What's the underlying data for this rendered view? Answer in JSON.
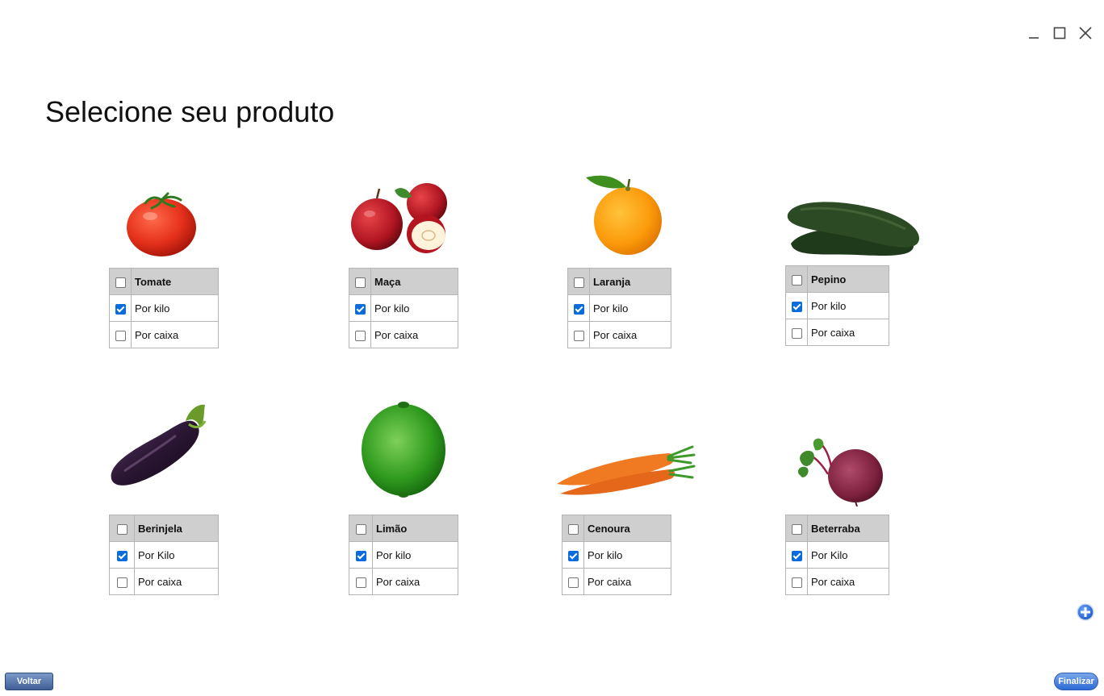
{
  "page": {
    "title": "Selecione seu produto"
  },
  "products": [
    {
      "name": "Tomate",
      "options": [
        {
          "label": "Por kilo",
          "checked": true
        },
        {
          "label": "Por caixa",
          "checked": false
        }
      ]
    },
    {
      "name": "Maça",
      "options": [
        {
          "label": "Por kilo",
          "checked": true
        },
        {
          "label": "Por caixa",
          "checked": false
        }
      ]
    },
    {
      "name": "Laranja",
      "options": [
        {
          "label": "Por kilo",
          "checked": true
        },
        {
          "label": "Por caixa",
          "checked": false
        }
      ]
    },
    {
      "name": "Pepino",
      "options": [
        {
          "label": "Por kilo",
          "checked": true
        },
        {
          "label": "Por caixa",
          "checked": false
        }
      ]
    },
    {
      "name": "Berinjela",
      "options": [
        {
          "label": "Por Kilo",
          "checked": true
        },
        {
          "label": "Por caixa",
          "checked": false
        }
      ]
    },
    {
      "name": "Limão",
      "options": [
        {
          "label": "Por kilo",
          "checked": true
        },
        {
          "label": "Por caixa",
          "checked": false
        }
      ]
    },
    {
      "name": "Cenoura",
      "options": [
        {
          "label": "Por kilo",
          "checked": true
        },
        {
          "label": "Por caixa",
          "checked": false
        }
      ]
    },
    {
      "name": "Beterraba",
      "options": [
        {
          "label": "Por Kilo",
          "checked": true
        },
        {
          "label": "Por caixa",
          "checked": false
        }
      ]
    }
  ],
  "footer": {
    "back_label": "Voltar",
    "finish_label": "Finalizar"
  },
  "icons": {
    "minimize": "minimize-icon",
    "maximize": "maximize-icon",
    "close": "close-icon",
    "add": "plus-circle-icon"
  },
  "colors": {
    "checkbox_accent": "#0a6bdc",
    "header_bg": "#cfcfcf",
    "back_button": "#4a6aa3",
    "finish_button": "#2d6ad6"
  }
}
